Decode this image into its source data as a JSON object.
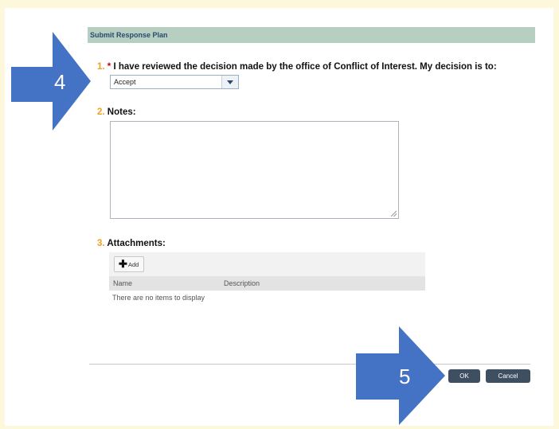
{
  "dialog": {
    "title": "Submit Response Plan"
  },
  "questions": [
    {
      "number": "1.",
      "required_marker": "*",
      "label": "I have reviewed the decision made by the office of Conflict of Interest. My decision is to:",
      "selected_value": "Accept"
    },
    {
      "number": "2.",
      "label": "Notes:",
      "value": ""
    },
    {
      "number": "3.",
      "label": "Attachments:",
      "add_label": "Add",
      "columns": [
        "Name",
        "Description"
      ],
      "empty_message": "There are no items to display"
    }
  ],
  "footer": {
    "ok_label": "OK",
    "cancel_label": "Cancel"
  },
  "callouts": [
    "4",
    "5"
  ],
  "colors": {
    "background": "#fdf8dc",
    "header_bar": "#b6cfc0",
    "header_text": "#2a4a6e",
    "question_number": "#f0a020",
    "required": "#d00000",
    "button": "#3f4f62",
    "callout": "#4472c4"
  },
  "icons": {
    "dropdown": "chevron-down-icon",
    "add": "plus-icon",
    "callout": "arrow-right-icon"
  }
}
